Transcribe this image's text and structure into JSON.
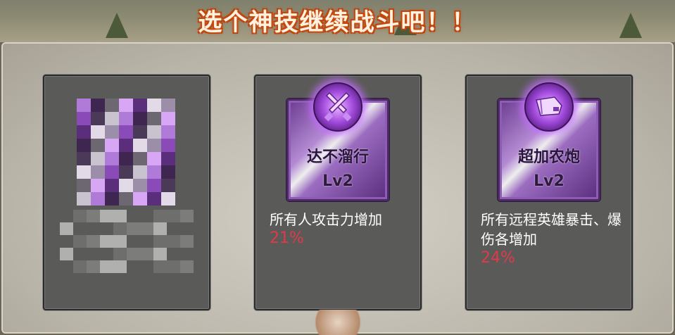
{
  "banner": {
    "title": "选个神技继续战斗吧！！"
  },
  "cards": [
    {
      "censored": true
    },
    {
      "skill_name": "达不溜行",
      "level": "Lv2",
      "description": "所有人攻击力增加",
      "value": "21%",
      "icon": "crossed-swords-icon"
    },
    {
      "skill_name": "超加农炮",
      "level": "Lv2",
      "description": "所有远程英雄暴击、爆伤各增加",
      "value": "24%",
      "icon": "cannon-icon"
    }
  ],
  "colors": {
    "value_red": "#e03a4a",
    "frame_purple": "#8c5db3",
    "card_bg": "#5a5a58"
  }
}
